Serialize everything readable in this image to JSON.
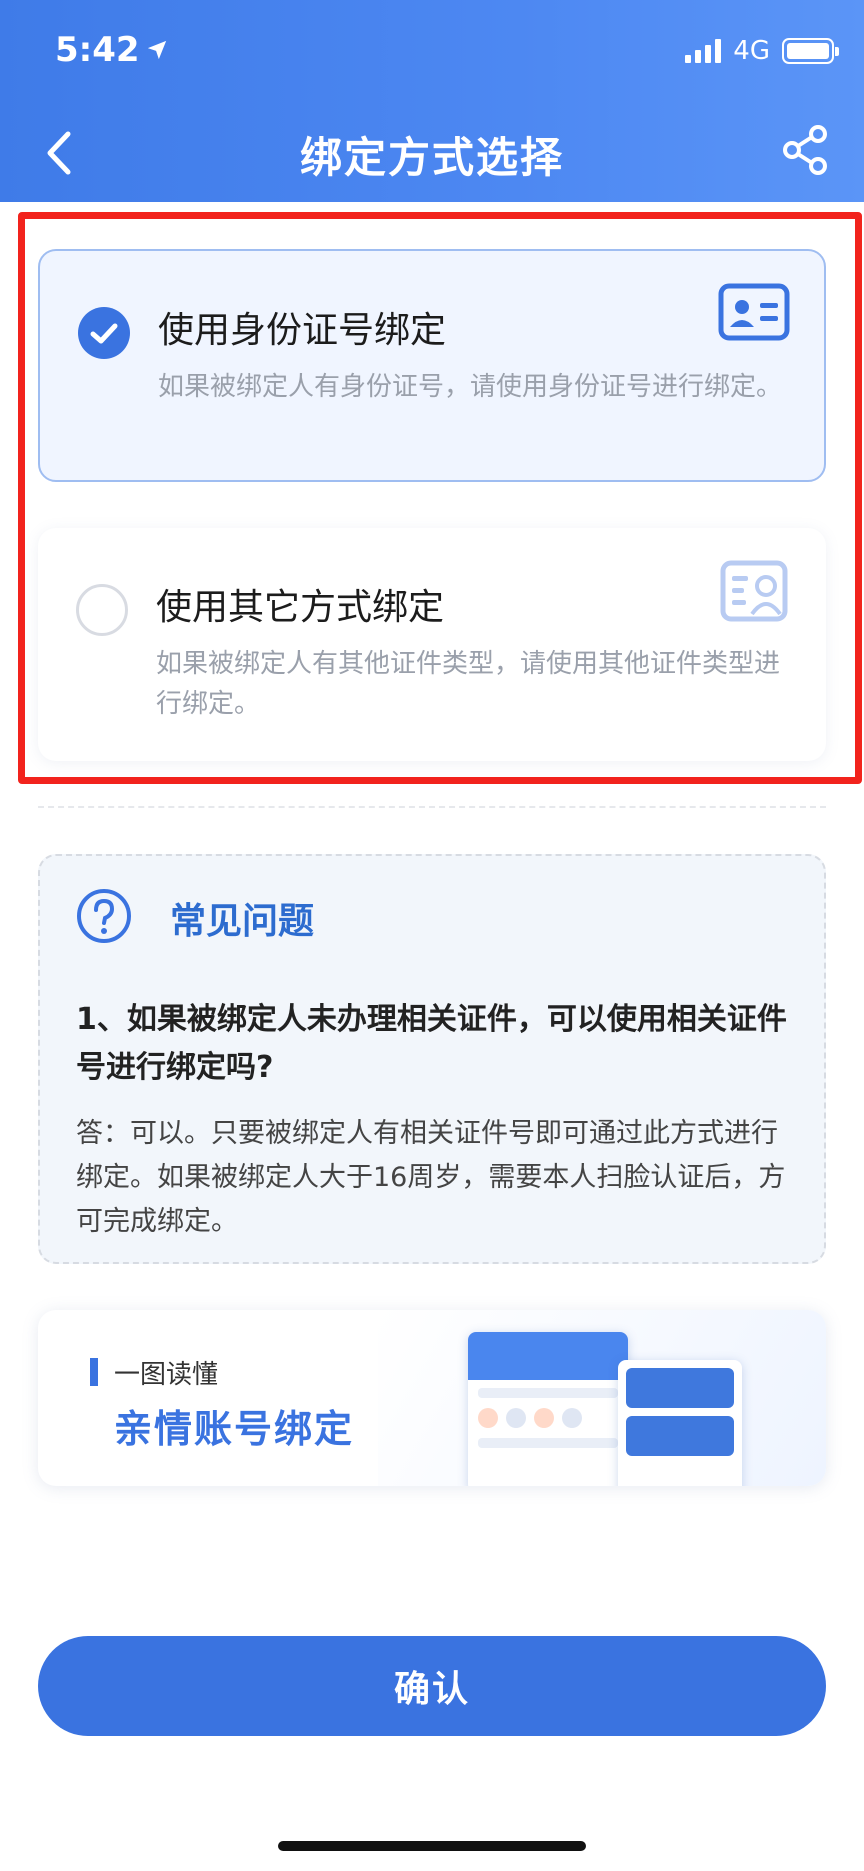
{
  "status_bar": {
    "time": "5:42",
    "network": "4G"
  },
  "nav": {
    "title": "绑定方式选择"
  },
  "options": [
    {
      "title": "使用身份证号绑定",
      "description": "如果被绑定人有身份证号，请使用身份证号进行绑定。",
      "selected": true,
      "icon": "id-card-icon"
    },
    {
      "title": "使用其它方式绑定",
      "description": "如果被绑定人有其他证件类型，请使用其他证件类型进行绑定。",
      "selected": false,
      "icon": "document-person-icon"
    }
  ],
  "faq": {
    "title": "常见问题",
    "question": "1、如果被绑定人未办理相关证件，可以使用相关证件号进行绑定吗?",
    "answer": "答：可以。只要被绑定人有相关证件号即可通过此方式进行绑定。如果被绑定人大于16周岁，需要本人扫脸认证后，方可完成绑定。"
  },
  "banner": {
    "subtitle": "一图读懂",
    "title": "亲情账号绑定"
  },
  "confirm_label": "确认",
  "colors": {
    "primary": "#3a73e0",
    "highlight_border": "#f2231d",
    "header_start": "#3f7be8",
    "header_end": "#5b95f7"
  }
}
